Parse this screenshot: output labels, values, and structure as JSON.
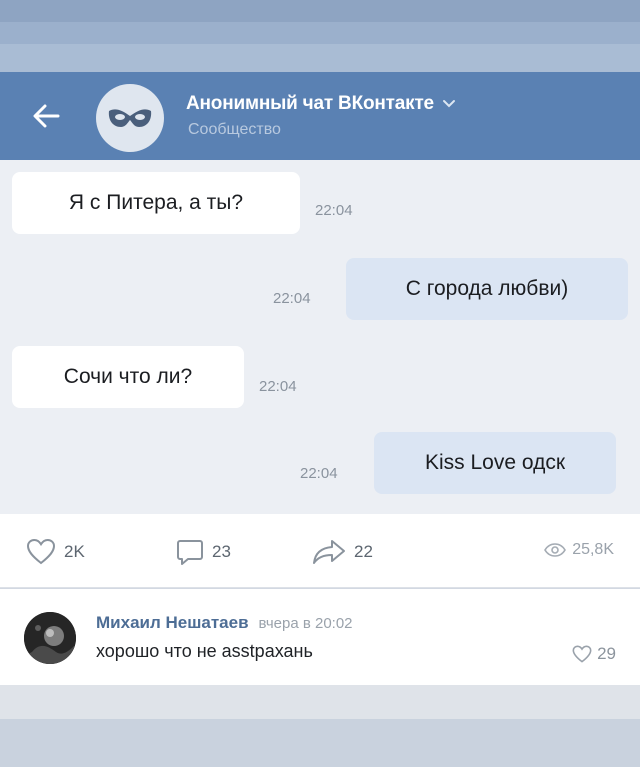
{
  "header": {
    "title": "Анонимный чат ВКонтакте",
    "subtitle": "Сообщество",
    "avatar_icon": "mask-icon",
    "back_icon": "arrow-left-icon",
    "dropdown_icon": "chevron-down-icon",
    "bg_color": "#5a81b3"
  },
  "messages": [
    {
      "direction": "incoming",
      "text": "Я с Питера, а ты?",
      "time": "22:04"
    },
    {
      "direction": "outgoing",
      "text": "С города любви)",
      "time": "22:04"
    },
    {
      "direction": "incoming",
      "text": "Сочи что ли?",
      "time": "22:04"
    },
    {
      "direction": "outgoing",
      "text": "Kiss Love одск",
      "time": "22:04"
    }
  ],
  "post_actions": {
    "likes": "2K",
    "comments": "23",
    "shares": "22",
    "views": "25,8K"
  },
  "comment": {
    "author": "Михаил Нешатаев",
    "date": "вчера в 20:02",
    "text": "хорошо что не asstрахань",
    "likes": "29"
  }
}
